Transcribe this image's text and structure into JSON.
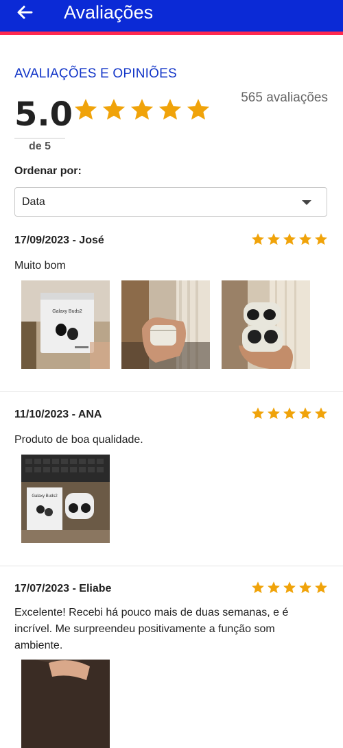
{
  "header": {
    "title": "Avaliações",
    "back_icon": "arrow-left-icon"
  },
  "summary": {
    "section_title": "AVALIAÇÕES E OPINIÕES",
    "rating": "5.0",
    "rating_of": "de 5",
    "stars": 5,
    "reviews_count": "565 avaliações"
  },
  "sort": {
    "label": "Ordenar por:",
    "value": "Data"
  },
  "reviews": [
    {
      "header": "17/09/2023 - José",
      "stars": 5,
      "text": "Muito bom",
      "photos": 3
    },
    {
      "header": "11/10/2023 - ANA",
      "stars": 5,
      "text": "Produto de boa qualidade.",
      "photos": 1
    },
    {
      "header": "17/07/2023 - Eliabe",
      "stars": 5,
      "text": "Excelente! Recebi há pouco mais de duas semanas, e é incrível. Me surpreendeu positivamente a função som ambiente.",
      "photos": 1
    }
  ],
  "colors": {
    "primary": "#0b2ad6",
    "accent_bar": "#ff2a4f",
    "star": "#f0a30a",
    "section_title": "#1336c8"
  }
}
